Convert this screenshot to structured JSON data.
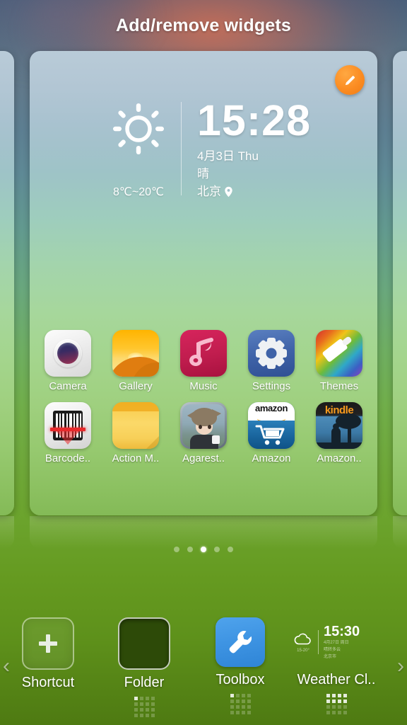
{
  "header": {
    "title": "Add/remove widgets"
  },
  "colors": {
    "accent_orange": "#fb8c22",
    "card_top": "#b9cbd8",
    "card_bottom": "#84ba57",
    "background_top": "#4a5f7a",
    "background_bottom": "#4e7a12",
    "active_dot": "#ffffff"
  },
  "edit_button": {
    "icon": "pencil-icon"
  },
  "widget_preview": {
    "weather_clock": {
      "weather_icon": "sun-icon",
      "temperature_range": "8℃~20℃",
      "time": "15:28",
      "date": "4月3日 Thu",
      "condition": "晴",
      "city": "北京",
      "location_icon": "location-pin-icon"
    },
    "apps": [
      [
        {
          "label": "Camera",
          "icon": "camera-icon"
        },
        {
          "label": "Gallery",
          "icon": "gallery-icon"
        },
        {
          "label": "Music",
          "icon": "music-icon"
        },
        {
          "label": "Settings",
          "icon": "settings-gear-icon"
        },
        {
          "label": "Themes",
          "icon": "themes-brush-icon"
        }
      ],
      [
        {
          "label": "Barcode..",
          "icon": "barcode-scanner-icon"
        },
        {
          "label": "Action M..",
          "icon": "action-memo-icon"
        },
        {
          "label": "Agarest..",
          "icon": "agarest-game-icon"
        },
        {
          "label": "Amazon",
          "icon": "amazon-cart-icon"
        },
        {
          "label": "Amazon..",
          "icon": "kindle-icon"
        }
      ]
    ]
  },
  "pagination": {
    "total": 5,
    "active_index": 2
  },
  "widget_tray": {
    "items": [
      {
        "label": "Shortcut",
        "icon": "plus-icon",
        "size_cols": 1,
        "size_rows": 1,
        "has_size_grid": false
      },
      {
        "label": "Folder",
        "icon": "folder-thumbnail-icon",
        "size_cols": 1,
        "size_rows": 1,
        "has_size_grid": true
      },
      {
        "label": "Toolbox",
        "icon": "wrench-icon",
        "size_cols": 1,
        "size_rows": 1,
        "has_size_grid": true
      },
      {
        "label": "Weather Cl..",
        "icon": "weather-clock-icon",
        "size_cols": 4,
        "size_rows": 2,
        "has_size_grid": true,
        "preview": {
          "weather_icon": "cloud-icon",
          "time": "15:30",
          "temp": "15-20°",
          "line1": "4月27日 周日",
          "line2": "晴转多云",
          "line3": "北京市"
        }
      }
    ]
  },
  "navigation": {
    "prev_icon": "chevron-left-icon",
    "next_icon": "chevron-right-icon"
  }
}
